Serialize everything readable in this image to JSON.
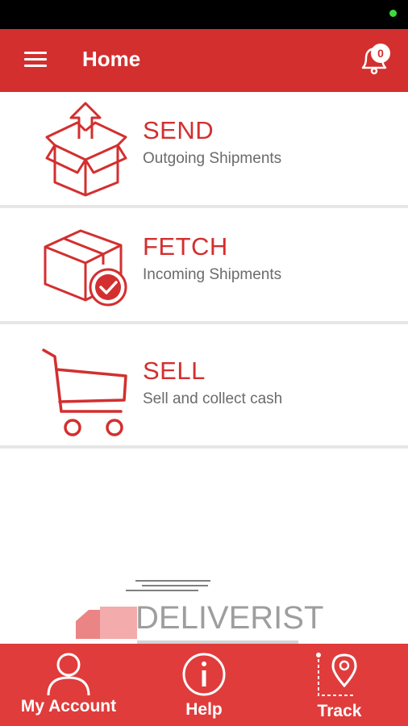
{
  "header": {
    "title": "Home",
    "notification_count": "0"
  },
  "menu": [
    {
      "title": "SEND",
      "subtitle": "Outgoing Shipments",
      "icon": "send-box-icon"
    },
    {
      "title": "FETCH",
      "subtitle": "Incoming Shipments",
      "icon": "fetch-box-icon"
    },
    {
      "title": "SELL",
      "subtitle": "Sell and collect cash",
      "icon": "shopping-cart-icon"
    }
  ],
  "brand": {
    "name": "DELIVERIST"
  },
  "bottom_nav": [
    {
      "label": "My Account",
      "icon": "user-icon"
    },
    {
      "label": "Help",
      "icon": "info-icon"
    },
    {
      "label": "Track",
      "icon": "location-pin-icon"
    }
  ],
  "colors": {
    "primary": "#d32f2f",
    "bottom_bar": "#e03c3c",
    "subtitle": "#6b6b6b"
  }
}
